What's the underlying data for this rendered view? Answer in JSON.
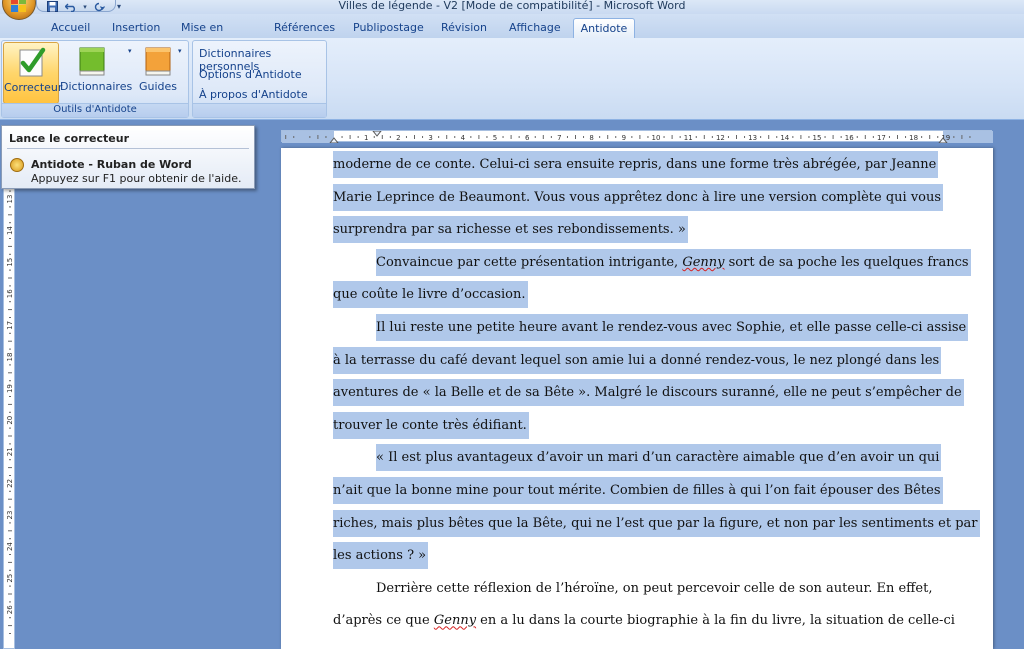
{
  "window": {
    "title": "Villes de légende - V2 [Mode de compatibilité] - Microsoft Word"
  },
  "quick_access": {
    "save": "save-icon",
    "undo": "undo-icon",
    "redo": "redo-icon",
    "customize": "▾"
  },
  "tabs": [
    {
      "label": "Accueil"
    },
    {
      "label": "Insertion"
    },
    {
      "label": "Mise en page"
    },
    {
      "label": "Références"
    },
    {
      "label": "Publipostage"
    },
    {
      "label": "Révision"
    },
    {
      "label": "Affichage"
    },
    {
      "label": "Antidote",
      "active": true
    }
  ],
  "ribbon": {
    "group1": {
      "label": "Outils d'Antidote",
      "correcteur": "Correcteur",
      "dictionnaires": "Dictionnaires",
      "guides": "Guides"
    },
    "group2": {
      "dict_perso": "Dictionnaires personnels",
      "options": "Options d'Antidote",
      "apropos": "À propos d'Antidote"
    }
  },
  "tooltip": {
    "title": "Lance le correcteur",
    "line1": "Antidote - Ruban de Word",
    "line2": "Appuyez sur F1 pour obtenir de l'aide."
  },
  "document": {
    "lines": [
      {
        "text": "moderne de ce conte. Celui-ci sera ensuite repris, dans une forme très abrégée, par Jeanne",
        "indent": false,
        "hl": true
      },
      {
        "text": "Marie Leprince de Beaumont. Vous vous apprêtez donc à lire une version complète qui vous",
        "indent": false,
        "hl": true
      },
      {
        "text": "surprendra par sa richesse et ses rebondissements. »",
        "indent": false,
        "hl": true
      },
      {
        "pre": "Convaincue par cette présentation intrigante, ",
        "squig": "Genny",
        "post": " sort de sa poche les quelques francs",
        "indent": true,
        "hl": true
      },
      {
        "text": "que coûte le livre d’occasion.",
        "indent": false,
        "hl": true
      },
      {
        "text": "Il lui reste une petite heure avant le  rendez-vous avec Sophie, et elle passe celle-ci assise",
        "indent": true,
        "hl": true
      },
      {
        "text": "à la terrasse du café devant lequel son amie lui a donné rendez-vous, le nez plongé dans les",
        "indent": false,
        "hl": true
      },
      {
        "text": "aventures de « la Belle et de sa Bête ». Malgré le discours suranné, elle ne peut s’empêcher de",
        "indent": false,
        "hl": true
      },
      {
        "text": "trouver le conte très édifiant.",
        "indent": false,
        "hl": true
      },
      {
        "text": "« Il est plus avantageux d’avoir un mari d’un caractère aimable que d’en avoir un qui",
        "indent": true,
        "hl": true
      },
      {
        "text": "n’ait que la bonne mine pour tout mérite. Combien de filles à qui l’on fait épouser des Bêtes",
        "indent": false,
        "hl": true
      },
      {
        "text": "riches, mais plus bêtes que la Bête, qui ne l’est que par la figure, et non par les sentiments et par",
        "indent": false,
        "hl": true
      },
      {
        "text": "les actions ? »",
        "indent": false,
        "hl": true
      },
      {
        "text": "Derrière cette réflexion de l’héroïne, on peut percevoir celle de son auteur. En effet,",
        "indent": true,
        "hl": false
      },
      {
        "pre": "d’après ce que ",
        "squig": "Genny",
        "post": " en a lu dans la courte biographie à la fin du livre, la situation  de celle-ci",
        "indent": false,
        "hl": false
      }
    ]
  },
  "hruler": {
    "labels": [
      "1",
      "2",
      "3",
      "4",
      "5",
      "6",
      "7",
      "8",
      "9",
      "10",
      "11",
      "12",
      "13",
      "14",
      "15",
      "16",
      "17",
      "18",
      "19"
    ]
  },
  "vruler": {
    "labels": [
      "13",
      "14",
      "15",
      "16",
      "17",
      "18",
      "19",
      "20",
      "21",
      "22",
      "23",
      "24",
      "25",
      "26"
    ]
  }
}
